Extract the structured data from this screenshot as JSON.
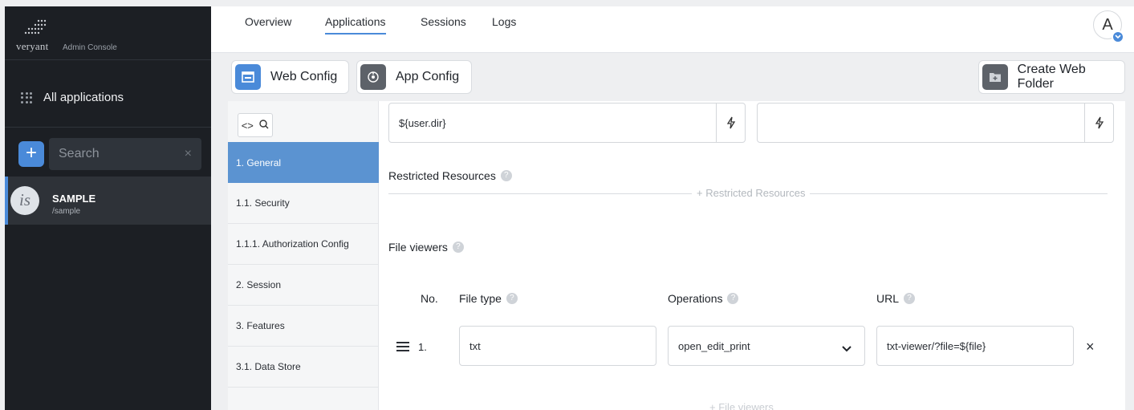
{
  "brand": {
    "word": "veryant",
    "subtitle": "Admin Console"
  },
  "sidebar": {
    "all_apps_label": "All applications",
    "search_placeholder": "Search",
    "add_label": "+",
    "clear_label": "×",
    "apps": [
      {
        "logo": "is",
        "name": "SAMPLE",
        "path": "/sample"
      }
    ]
  },
  "nav": {
    "tabs": [
      {
        "label": "Overview"
      },
      {
        "label": "Applications"
      },
      {
        "label": "Sessions"
      },
      {
        "label": "Logs"
      }
    ],
    "active": "Applications",
    "avatar": "A"
  },
  "toolbar": {
    "web_config": "Web Config",
    "app_config": "App Config",
    "create_web_folder": "Create Web Folder"
  },
  "subnav": {
    "items": [
      {
        "label": "1. General"
      },
      {
        "label": "1.1. Security"
      },
      {
        "label": "1.1.1. Authorization Config"
      },
      {
        "label": "2. Session"
      },
      {
        "label": "3. Features"
      },
      {
        "label": "3.1. Data Store"
      }
    ]
  },
  "form": {
    "field1_value": "${user.dir}",
    "field2_value": "",
    "restricted_label": "Restricted Resources",
    "restricted_add": "+ Restricted Resources",
    "file_viewers_label": "File viewers",
    "columns": {
      "no": "No.",
      "file_type": "File type",
      "operations": "Operations",
      "url": "URL"
    },
    "rows": [
      {
        "no": "1.",
        "file_type": "txt",
        "operations": "open_edit_print",
        "url": "txt-viewer/?file=${file}"
      }
    ],
    "file_viewers_add": "+ File viewers",
    "remove_label": "×"
  },
  "colors": {
    "accent": "#4a8ad9",
    "sidebar_bg": "#1c1f24",
    "active_item": "#5b93d1"
  }
}
